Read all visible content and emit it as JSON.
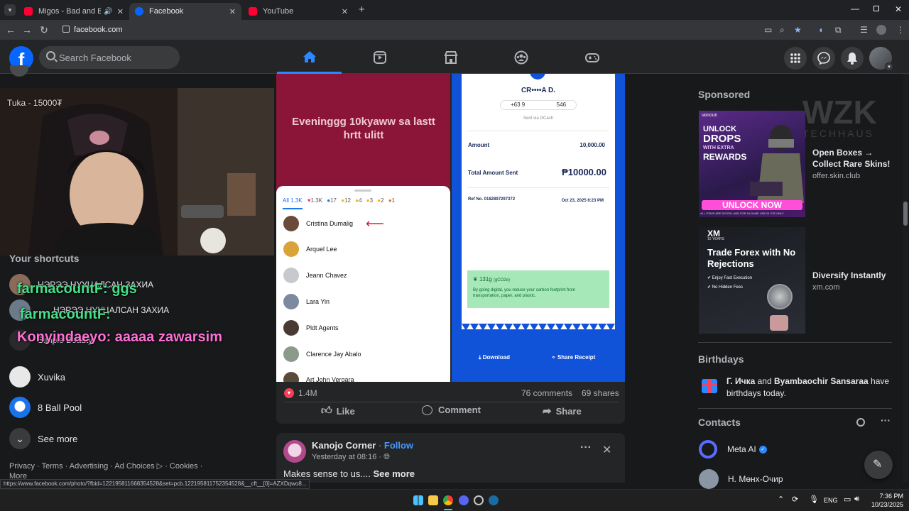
{
  "browser": {
    "tabs": [
      {
        "title": "Migos - Bad and Boujee ft L",
        "color": "#ff0033"
      },
      {
        "title": "Facebook",
        "color": "#0866ff"
      },
      {
        "title": "YouTube",
        "color": "#ff0033"
      }
    ],
    "url": "facebook.com",
    "status_url": "https://www.facebook.com/photo/?fbid=122195811668354528&set=pcb.122195811752354528&__cft__[0]=AZXDqwo8..."
  },
  "fb": {
    "search_placeholder": "Search Facebook"
  },
  "left": {
    "webcam_caption": "Tuka - 15000₮",
    "shortcuts_heading": "Your shortcuts",
    "shortcut_1": "НЭРЭЭ НУУЦАЛСАН ЗАХИА",
    "shortcut_2": "НЭРЭЭ НУУЦАЛСАН ЗАХИА",
    "shortcut_3": "Simple Beauty",
    "shortcut_4": "Xuvika",
    "shortcut_5": "8 Ball Pool",
    "see_more": "See more",
    "chat_1": "farmacountF: ggs",
    "chat_2": "farmacountF:",
    "chat_3": "Konyindaeyo: aaaaa zawarsim",
    "footer": [
      "Privacy",
      "Terms",
      "Advertising",
      "Ad Choices",
      "Cookies",
      "More"
    ]
  },
  "post1": {
    "left_image_text": "Eveninggg 10kyaww sa lastt hrtt ulitt",
    "reaction_tabs": {
      "all": "All 1.3K",
      "heart": "1.3K",
      "like": "17",
      "wow": "12",
      "haha": "4",
      "care": "3",
      "sad": "2",
      "angry": "1"
    },
    "people": [
      "Cristina Dumalig",
      "Arquel Lee",
      "Jeann Chavez",
      "Lara Yin",
      "Pldt Agents",
      "Clarence Jay Abalo",
      "Art John Vergara"
    ],
    "receipt": {
      "name": "CR••••A D.",
      "phone_start": "+63 9",
      "phone_end": "546",
      "sent_via": "Sent via GCash",
      "amount_label": "Amount",
      "amount": "10,000.00",
      "total_label": "Total Amount Sent",
      "total": "₱10000.00",
      "ref": "Ref No. 0182897297372",
      "date": "Oct 23, 2025 6:23 PM",
      "green_value": "131g",
      "green_unit": "(gCO2e)",
      "green_text": "By going digital, you reduce your carbon footprint from transportation, paper, and plastic.",
      "download": "Download",
      "share_receipt": "Share Receipt"
    },
    "reactions_count": "1.4M",
    "comments": "76 comments",
    "shares": "69 shares",
    "like": "Like",
    "comment": "Comment",
    "share": "Share"
  },
  "post2": {
    "author": "Kanojo Corner",
    "follow": "Follow",
    "time": "Yesterday at 08:16",
    "text": "Makes sense to us....",
    "see_more": "See more"
  },
  "right": {
    "sponsored": "Sponsored",
    "watermark_1": "WZK",
    "watermark_2": "TECHHAUS",
    "ad1": {
      "img_brand": "skinclub",
      "img_line1": "UNLOCK",
      "img_line2": "DROPS",
      "img_line3": "WITH EXTRA",
      "img_line4": "REWARDS",
      "img_button": "UNLOCK NOW",
      "img_fine": "ALL ITEMS ARE DIGITAL AND FOR IN-GAME USE IN CS2 ONLY",
      "title": "Open Boxes → Collect Rare Skins!",
      "url": "offer.skin.club"
    },
    "ad2": {
      "img_brand": "XM",
      "img_years": "15 YEARS",
      "img_title": "Trade Forex with No Rejections",
      "img_b1": "Enjoy Fast Execution",
      "img_b2": "No Hidden Fees",
      "title": "Diversify Instantly",
      "url": "xm.com"
    },
    "birthdays_heading": "Birthdays",
    "bday_name1": "Г. Ичка",
    "bday_and": "and",
    "bday_name2": "Byambaochir Sansaraa",
    "bday_rest": "have birthdays today.",
    "contacts_heading": "Contacts",
    "contact_1": "Meta AI",
    "contact_2": "Н. Мөнх-Очир"
  },
  "taskbar": {
    "lang": "ENG",
    "time": "7:36 PM",
    "date": "10/23/2025"
  }
}
